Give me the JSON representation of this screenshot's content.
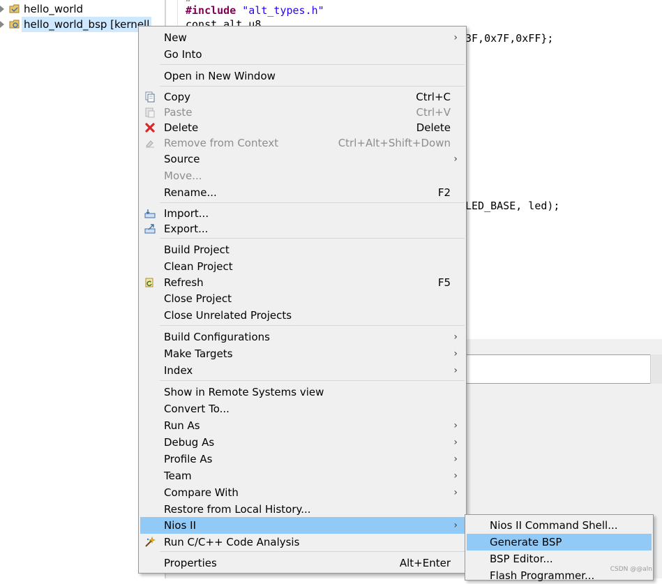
{
  "explorer": {
    "items": [
      {
        "label": "hello_world"
      },
      {
        "label": "hello_world_bsp [kernell"
      }
    ]
  },
  "editor": {
    "line1": {
      "keyword": "#include",
      "string": "\"alt_types.h\""
    },
    "line2": "const alt_u8",
    "line3": "3F,0x7F,0xFF};",
    "line4": "LED_BASE, led);"
  },
  "menu": {
    "items": [
      {
        "label": "New",
        "submenu": true
      },
      {
        "label": "Go Into"
      },
      {
        "label": "Open in New Window"
      },
      {
        "label": "Copy",
        "shortcut": "Ctrl+C",
        "icon": "copy-icon"
      },
      {
        "label": "Paste",
        "shortcut": "Ctrl+V",
        "icon": "paste-icon",
        "disabled": true
      },
      {
        "label": "Delete",
        "shortcut": "Delete",
        "icon": "delete-icon"
      },
      {
        "label": "Remove from Context",
        "shortcut": "Ctrl+Alt+Shift+Down",
        "icon": "remove-context-icon",
        "disabled": true
      },
      {
        "label": "Source",
        "submenu": true
      },
      {
        "label": "Move...",
        "disabled": true
      },
      {
        "label": "Rename...",
        "shortcut": "F2"
      },
      {
        "label": "Import...",
        "icon": "import-icon"
      },
      {
        "label": "Export...",
        "icon": "export-icon"
      },
      {
        "label": "Build Project"
      },
      {
        "label": "Clean Project"
      },
      {
        "label": "Refresh",
        "shortcut": "F5",
        "icon": "refresh-icon"
      },
      {
        "label": "Close Project"
      },
      {
        "label": "Close Unrelated Projects"
      },
      {
        "label": "Build Configurations",
        "submenu": true
      },
      {
        "label": "Make Targets",
        "submenu": true
      },
      {
        "label": "Index",
        "submenu": true
      },
      {
        "label": "Show in Remote Systems view"
      },
      {
        "label": "Convert To..."
      },
      {
        "label": "Run As",
        "submenu": true
      },
      {
        "label": "Debug As",
        "submenu": true
      },
      {
        "label": "Profile As",
        "submenu": true
      },
      {
        "label": "Team",
        "submenu": true
      },
      {
        "label": "Compare With",
        "submenu": true
      },
      {
        "label": "Restore from Local History..."
      },
      {
        "label": "Nios II",
        "submenu": true,
        "highlighted": true
      },
      {
        "label": "Run C/C++ Code Analysis",
        "icon": "code-analysis-icon"
      },
      {
        "label": "Properties",
        "shortcut": "Alt+Enter"
      }
    ]
  },
  "submenu": {
    "items": [
      {
        "label": "Nios II Command Shell..."
      },
      {
        "label": "Generate BSP",
        "highlighted": true
      },
      {
        "label": "BSP Editor..."
      },
      {
        "label": "Flash Programmer..."
      }
    ]
  },
  "watermark": "CSDN @@aln",
  "colors": {
    "highlight": "#91c9f7",
    "menu_bg": "#f0f0f0",
    "keyword": "#7f0055",
    "string": "#2a00ff",
    "delete_icon": "#d9262b"
  }
}
